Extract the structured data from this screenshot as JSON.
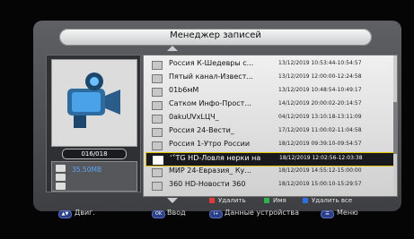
{
  "header": {
    "title": "Менеджер записей"
  },
  "left": {
    "counter": "016/018",
    "storage": "35.50MB",
    "icons": [
      "video-camera",
      "hdd",
      "usb",
      "folder"
    ]
  },
  "records": [
    {
      "title": "Россия К-Шедевры с...",
      "time": "13/12/2019 10:53:44-10:54:57"
    },
    {
      "title": "Пятый канал-Извест...",
      "time": "13/12/2019 12:00:00-12:24:58"
    },
    {
      "title": "01b6мМ",
      "time": "13/12/2019 10:48:54-10:49:17"
    },
    {
      "title": "Сатком Инфо-Прост...",
      "time": "14/12/2019 20:00:02-20:14:57"
    },
    {
      "title": "0akuUVxLЦЧ_",
      "time": "04/12/2019 13:10:18-13:11:09"
    },
    {
      "title": "Россия 24-Вести_",
      "time": "17/12/2019 11:00:02-11:04:58"
    },
    {
      "title": "Россия 1-Утро России",
      "time": "18/12/2019 09:39:10-09:54:57"
    },
    {
      "title": "ʻ˂TG HD-Ловля нерки на",
      "time": "18/12/2019 12:02:56-12:03:38"
    },
    {
      "title": "МИР 24-Евразия_ Ку...",
      "time": "18/12/2019 14:55:12-15:00:00"
    },
    {
      "title": "360 HD-Новости 360",
      "time": "18/12/2019 15:00:10-15:29:57"
    }
  ],
  "selected_index": 7,
  "legend": [
    {
      "label": "Удалить",
      "color": "#e23b3b"
    },
    {
      "label": "Имя",
      "color": "#2fb34a"
    },
    {
      "label": "Удалить все",
      "color": "#2f6ee3"
    }
  ],
  "bottom": {
    "move": "Двиг.",
    "ok_key": "OK",
    "enter": "Ввод",
    "info_key": "i+",
    "device": "Данные устройства",
    "menu": "Меню"
  }
}
